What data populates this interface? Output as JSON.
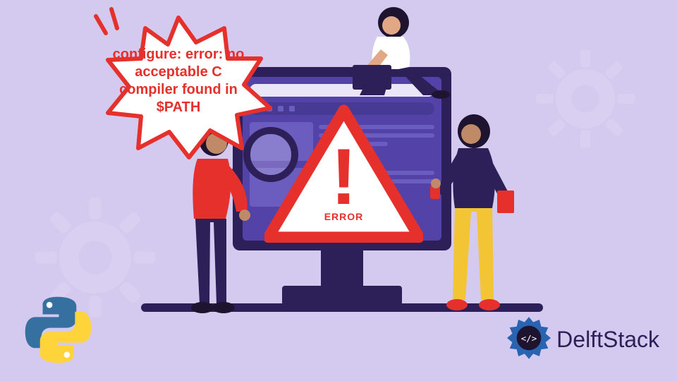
{
  "bubble_text": "configure: error: no acceptable C compiler found in $PATH",
  "warning_label": "ERROR",
  "brand_name": "DelftStack",
  "colors": {
    "background": "#d4caef",
    "accent_red": "#e6302b",
    "dark_purple": "#2d1f58",
    "mid_purple": "#5342a8"
  }
}
